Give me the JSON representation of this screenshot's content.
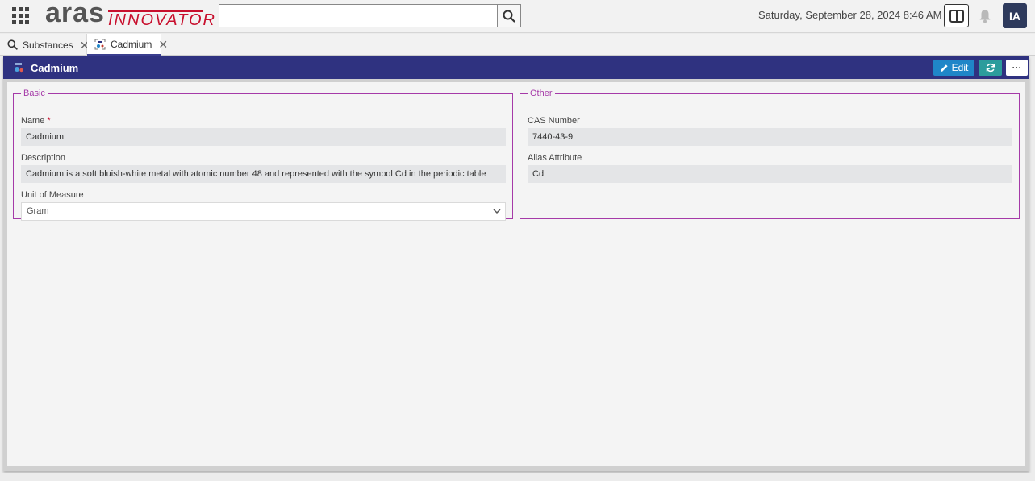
{
  "header": {
    "logo_main": "aras",
    "logo_sub": "INNOVATOR",
    "search": {
      "value": "",
      "placeholder": ""
    },
    "datetime": "Saturday, September 28, 2024 8:46 AM",
    "user_initials": "IA",
    "icons": [
      "apps-grid-icon",
      "search-icon",
      "split-layout-icon",
      "bell-icon"
    ]
  },
  "tabs": [
    {
      "label": "Substances",
      "icon": "search-icon",
      "active": false
    },
    {
      "label": "Cadmium",
      "icon": "substance-icon",
      "active": true
    }
  ],
  "item": {
    "title": "Cadmium",
    "actions": {
      "edit_label": "Edit",
      "refresh": "refresh-icon",
      "more": "···"
    }
  },
  "form": {
    "basic": {
      "legend": "Basic",
      "name_label": "Name",
      "name_required": "*",
      "name_value": "Cadmium",
      "description_label": "Description",
      "description_value": "Cadmium is a soft bluish-white metal with atomic number 48 and represented with the symbol Cd in the periodic table",
      "uom_label": "Unit of Measure",
      "uom_value": "Gram"
    },
    "other": {
      "legend": "Other",
      "cas_label": "CAS Number",
      "cas_value": "7440-43-9",
      "alias_label": "Alias Attribute",
      "alias_value": "Cd"
    }
  },
  "colors": {
    "titlebar": "#2f3280",
    "edit_button": "#1f86c8",
    "refresh_button": "#2c9c9c",
    "group_border": "#a53aa8",
    "brand_red": "#c8102e",
    "avatar": "#2e3a5c"
  }
}
